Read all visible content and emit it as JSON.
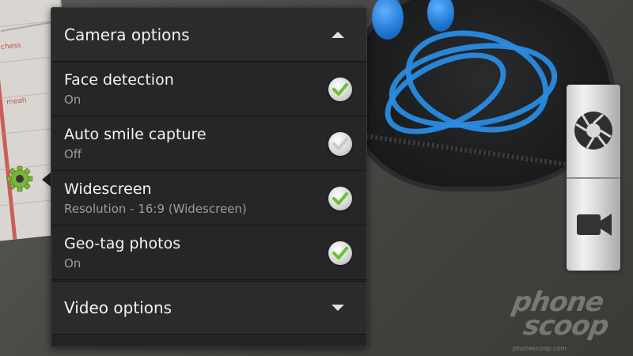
{
  "camera_options": {
    "title": "Camera options",
    "items": [
      {
        "label": "Face detection",
        "value": "On",
        "checked": true
      },
      {
        "label": "Auto smile capture",
        "value": "Off",
        "checked": false
      },
      {
        "label": "Widescreen",
        "value": "Resolution - 16:9 (Widescreen)",
        "checked": true
      },
      {
        "label": "Geo-tag photos",
        "value": "On",
        "checked": true
      }
    ]
  },
  "video_options": {
    "title": "Video options"
  },
  "controls": {
    "shutter_icon": "aperture-icon",
    "video_icon": "video-camera-icon"
  },
  "side": {
    "settings_icon": "gear-icon"
  },
  "background": {
    "paper_scribble": "meah",
    "paper_scribble_top": "chess"
  },
  "watermark": {
    "line1": "phone",
    "line2": "scoop",
    "line3": "phonescoop.com"
  },
  "colors": {
    "check_green": "#6fbf2e",
    "check_gray": "#c8c8c8",
    "gear_green": "#7ab43a",
    "panel_bg": "#232323"
  }
}
